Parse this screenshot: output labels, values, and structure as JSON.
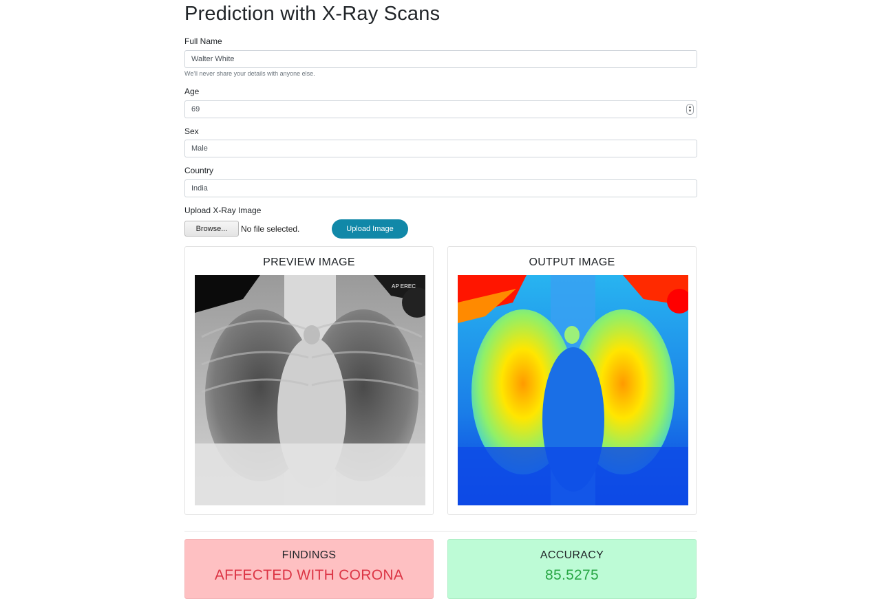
{
  "page": {
    "title": "Prediction with X-Ray Scans"
  },
  "form": {
    "full_name": {
      "label": "Full Name",
      "value": "Walter White",
      "help": "We'll never share your details with anyone else."
    },
    "age": {
      "label": "Age",
      "value": "69"
    },
    "sex": {
      "label": "Sex",
      "value": "Male"
    },
    "country": {
      "label": "Country",
      "value": "India"
    },
    "upload": {
      "label": "Upload X-Ray Image",
      "browse_label": "Browse...",
      "file_status": "No file selected.",
      "upload_label": "Upload Image"
    }
  },
  "preview": {
    "title": "PREVIEW IMAGE",
    "image_tag": "AP EREC",
    "image_icon": "xray-grayscale-image"
  },
  "output": {
    "title": "OUTPUT IMAGE",
    "image_icon": "xray-heatmap-image"
  },
  "findings": {
    "title": "FINDINGS",
    "value": "AFFECTED WITH CORONA",
    "bg": "#fec0c2",
    "border": "#f5b5b8",
    "color": "#dc3545"
  },
  "accuracy": {
    "title": "ACCURACY",
    "value": "85.5275",
    "bg": "#bdfbd6",
    "border": "#aeeec6",
    "color": "#28a745"
  },
  "colors": {
    "accent": "#1188a8"
  }
}
